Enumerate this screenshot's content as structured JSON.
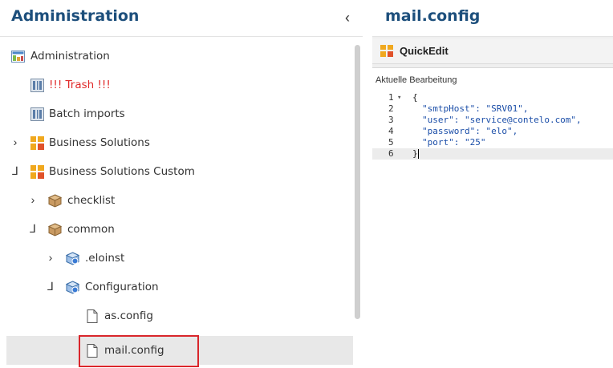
{
  "left_panel": {
    "title": "Administration",
    "collapse_icon": "chevron-left-icon",
    "collapse_glyph": "‹"
  },
  "tree": [
    {
      "label": "Administration",
      "icon": "administration-icon",
      "toggle": ""
    },
    {
      "label": "!!! Trash !!!",
      "icon": "folder-register-icon",
      "toggle": ""
    },
    {
      "label": "Batch imports",
      "icon": "folder-register-icon",
      "toggle": ""
    },
    {
      "label": "Business Solutions",
      "icon": "business-solutions-icon",
      "toggle": "›"
    },
    {
      "label": "Business Solutions Custom",
      "icon": "business-solutions-icon",
      "toggle": "⅃"
    },
    {
      "label": "checklist",
      "icon": "package-icon",
      "toggle": "›"
    },
    {
      "label": "common",
      "icon": "package-icon",
      "toggle": "⅃"
    },
    {
      "label": ".eloinst",
      "icon": "config-package-icon",
      "toggle": "›"
    },
    {
      "label": "Configuration",
      "icon": "config-package-icon",
      "toggle": "⅃"
    },
    {
      "label": "as.config",
      "icon": "file-icon",
      "toggle": ""
    },
    {
      "label": "mail.config",
      "icon": "file-icon",
      "toggle": "",
      "selected": true
    }
  ],
  "right_panel": {
    "title": "mail.config",
    "quickedit_label": "QuickEdit",
    "tab_label": "Aktuelle Bearbeitung"
  },
  "code": {
    "fold_marker": "▾",
    "lines": [
      {
        "n": "1",
        "text": "{"
      },
      {
        "n": "2",
        "text": "\"smtpHost\": \"SRV01\","
      },
      {
        "n": "3",
        "text": "\"user\": \"service@contelo.com\","
      },
      {
        "n": "4",
        "text": "\"password\": \"elo\","
      },
      {
        "n": "5",
        "text": "\"port\": \"25\""
      },
      {
        "n": "6",
        "text": "}"
      }
    ]
  },
  "colors": {
    "title": "#1d4f7c",
    "trash_text": "#e02b2b",
    "highlight_border": "#d9262b",
    "business_solutions_orange": "#f0a81e",
    "package_tan": "#b98a55",
    "config_blue": "#3a7bd5"
  }
}
